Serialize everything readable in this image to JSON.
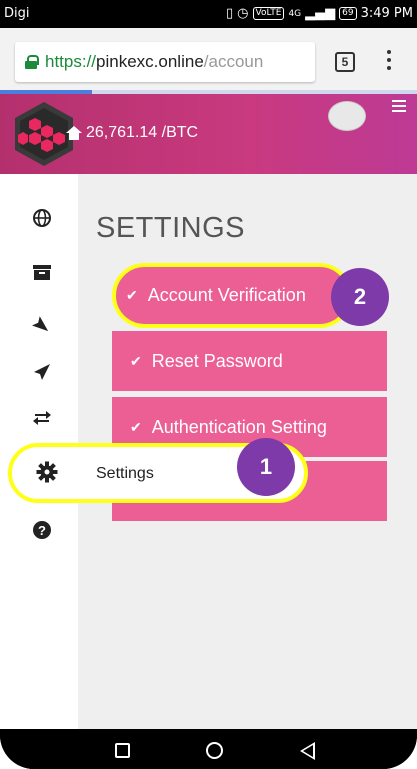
{
  "statusbar": {
    "carrier": "Digi",
    "volte": "VoLTE",
    "network": "4G",
    "battery": "69",
    "time": "3:49 PM"
  },
  "browser": {
    "url_scheme": "https://",
    "url_host": "pinkexc.online",
    "url_path": "/accoun",
    "tab_count": "5",
    "load_progress": 0.22
  },
  "header": {
    "balance": "26,761.14 /BTC",
    "brand_color": "#c23a7f"
  },
  "sidebar": {
    "items": [
      {
        "icon": "globe-icon"
      },
      {
        "icon": "archive-icon"
      },
      {
        "icon": "send-alt-icon"
      },
      {
        "icon": "paper-plane-icon"
      },
      {
        "icon": "exchange-icon"
      },
      {
        "icon": "gear-icon",
        "label": "Settings"
      },
      {
        "icon": "question-circle-icon"
      }
    ]
  },
  "main": {
    "title": "SETTINGS",
    "buttons": [
      {
        "label": "Account Verification"
      },
      {
        "label": "Reset Password"
      },
      {
        "label": "Authentication Setting"
      },
      {
        "label": ""
      }
    ],
    "accent": "#ec5f94"
  },
  "annotations": {
    "badge1": "1",
    "badge2": "2",
    "highlight_color": "#ffff1a",
    "badge_color": "#7d3aa8"
  }
}
